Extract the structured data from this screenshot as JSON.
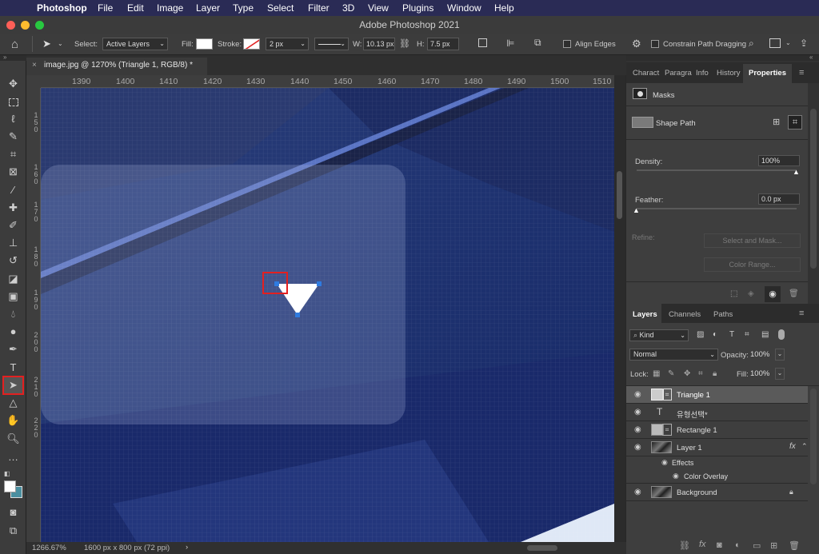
{
  "menubar": {
    "app_name": "Photoshop",
    "items": [
      "File",
      "Edit",
      "Image",
      "Layer",
      "Type",
      "Select",
      "Filter",
      "3D",
      "Plugins",
      "Window",
      "Help"
    ]
  },
  "window": {
    "title": "Adobe Photoshop 2021"
  },
  "options": {
    "select_label": "Select:",
    "select_value": "Active Layers",
    "fill_label": "Fill:",
    "stroke_label": "Stroke:",
    "stroke_width": "2 px",
    "w_label": "W:",
    "w_value": "10.13 px",
    "h_label": "H:",
    "h_value": "7.5 px",
    "align_edges": "Align Edges",
    "constrain": "Constrain Path Dragging"
  },
  "document": {
    "tab_title": "image.jpg @ 1270% (Triangle 1, RGB/8) *",
    "ruler_top": [
      "1390",
      "1400",
      "1410",
      "1420",
      "1430",
      "1440",
      "1450",
      "1460",
      "1470",
      "1480",
      "1490",
      "1500",
      "1510"
    ],
    "ruler_left": [
      [
        "1",
        "5",
        "0"
      ],
      [
        "1",
        "6",
        "0"
      ],
      [
        "1",
        "7",
        "0"
      ],
      [
        "1",
        "8",
        "0"
      ],
      [
        "1",
        "9",
        "0"
      ],
      [
        "2",
        "0",
        "0"
      ],
      [
        "2",
        "1",
        "0"
      ],
      [
        "2",
        "2",
        "0"
      ]
    ],
    "zoom": "1266.67%",
    "doc_info": "1600 px x 800 px (72 ppi)"
  },
  "properties_panel": {
    "tabs": [
      "Charact",
      "Paragra",
      "Info",
      "History",
      "Properties"
    ],
    "active_tab": "Properties",
    "masks_label": "Masks",
    "shape_path_label": "Shape Path",
    "density_label": "Density:",
    "density_value": "100%",
    "density_level": 1.0,
    "feather_label": "Feather:",
    "feather_value": "0.0 px",
    "feather_level": 0.0,
    "refine_label": "Refine:",
    "select_mask_btn": "Select and Mask...",
    "color_range_btn": "Color Range..."
  },
  "layers_panel": {
    "tabs": [
      "Layers",
      "Channels",
      "Paths"
    ],
    "active_tab": "Layers",
    "kind_filter": "Kind",
    "blend_mode": "Normal",
    "opacity_label": "Opacity:",
    "opacity_value": "100%",
    "lock_label": "Lock:",
    "fill_label": "Fill:",
    "fill_value": "100%",
    "layers": [
      {
        "name": "Triangle 1",
        "kind": "shape",
        "selected": true
      },
      {
        "name": "유형선택*",
        "kind": "type",
        "selected": false
      },
      {
        "name": "Rectangle 1",
        "kind": "shape",
        "selected": false
      },
      {
        "name": "Layer 1",
        "kind": "image",
        "selected": false,
        "fx": "fx"
      },
      {
        "name": "Effects",
        "kind": "effects",
        "selected": false
      },
      {
        "name": "Color Overlay",
        "kind": "effect",
        "selected": false
      },
      {
        "name": "Background",
        "kind": "image",
        "selected": false,
        "locked": true
      }
    ]
  },
  "colors": {
    "menubar_bg": "#2a2b55",
    "canvas_bg": "#1d2d5e",
    "selection_red": "#e32020",
    "anchor_blue": "#2f7be0",
    "panel_bg": "#323232"
  }
}
